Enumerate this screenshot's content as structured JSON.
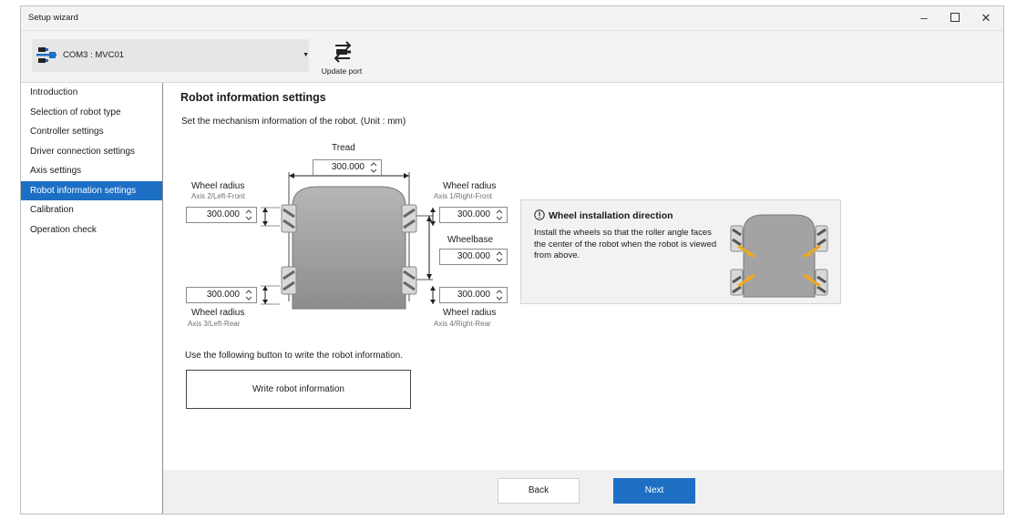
{
  "window": {
    "title": "Setup wizard"
  },
  "toolbar": {
    "port_value": "COM3 : MVC01",
    "update_port_label": "Update port"
  },
  "sidebar": {
    "items": [
      {
        "label": "Introduction"
      },
      {
        "label": "Selection of robot type"
      },
      {
        "label": "Controller settings"
      },
      {
        "label": "Driver connection settings"
      },
      {
        "label": "Axis settings"
      },
      {
        "label": "Robot information settings"
      },
      {
        "label": "Calibration"
      },
      {
        "label": "Operation check"
      }
    ]
  },
  "main": {
    "heading": "Robot information settings",
    "description": "Set the mechanism information of the robot. (Unit : mm)",
    "tread": {
      "label": "Tread",
      "value": "300.000"
    },
    "wheelbase": {
      "label": "Wheelbase",
      "value": "300.000"
    },
    "wheels": {
      "front_left": {
        "label": "Wheel radius",
        "axis": "Axis 2/Left-Front",
        "value": "300.000"
      },
      "front_right": {
        "label": "Wheel radius",
        "axis": "Axis 1/Right-Front",
        "value": "300.000"
      },
      "rear_left": {
        "label": "Wheel radius",
        "axis": "Axis 3/Left-Rear",
        "value": "300.000"
      },
      "rear_right": {
        "label": "Wheel radius",
        "axis": "Axis 4/Right-Rear",
        "value": "300.000"
      }
    },
    "info": {
      "title": "Wheel installation direction",
      "text": "Install the wheels so that the roller angle faces the center of the robot when the robot is viewed from above."
    },
    "write_note": "Use the following button to write the robot information.",
    "write_button": "Write robot information"
  },
  "footer": {
    "back": "Back",
    "next": "Next"
  },
  "colors": {
    "accent": "#1d6fc4",
    "arrow": "#f0a81e",
    "body": "#a9a9a9"
  },
  "icons": [
    "connector-icon",
    "refresh-port-icon",
    "spin-arrows-icon",
    "info-icon"
  ]
}
